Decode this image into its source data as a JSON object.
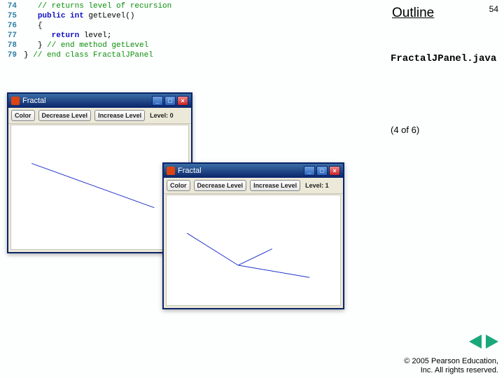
{
  "slide": {
    "number": "54",
    "outline": "Outline"
  },
  "file": {
    "name": "FractalJPanel.java",
    "progress": "(4 of 6)"
  },
  "code": {
    "lines": [
      {
        "n": "74",
        "comment": "// returns level of recursion"
      },
      {
        "n": "75",
        "kw": "public int",
        "rest": " getLevel()"
      },
      {
        "n": "76",
        "rest": "{"
      },
      {
        "n": "77",
        "kw": "return",
        "rest": " level;"
      },
      {
        "n": "78",
        "rest": "} ",
        "comment": "// end method getLevel"
      },
      {
        "n": "79",
        "rest0": "} ",
        "comment": "// end class FractalJPanel"
      }
    ]
  },
  "window": {
    "title": "Fractal",
    "buttons": {
      "color": "Color",
      "decrease": "Decrease Level",
      "increase": "Increase Level"
    },
    "levelLabel0": "Level: 0",
    "levelLabel1": "Level: 1",
    "controls": {
      "min": "_",
      "max": "□",
      "close": "×"
    }
  },
  "nav": {
    "prev": "prev-slide",
    "next": "next-slide"
  },
  "copyright": {
    "line1": "© 2005 Pearson Education,",
    "line2": "Inc.  All rights reserved."
  }
}
